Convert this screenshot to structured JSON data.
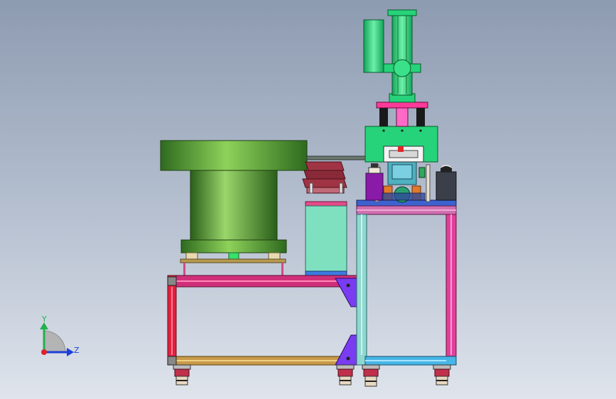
{
  "viewport": {
    "background_top": "#8d9bb1",
    "background_bottom": "#dfe4ec"
  },
  "triad": {
    "y_label": "Y",
    "z_label": "Z",
    "y_color": "#22b14c",
    "z_color": "#1f3fd6",
    "origin_color": "#e0202a"
  },
  "colors": {
    "bowl_green": "#3f8f2a",
    "pneumatic_green": "#26d37a",
    "frame_magenta": "#d0307a",
    "frame_red": "#e02040",
    "frame_tan": "#c79a4a",
    "frame_cyan": "#47b6e6",
    "bracket_purple": "#7a3cf0",
    "hopper_mint": "#7fe0c0",
    "chute_maroon": "#9a2a3a",
    "motor_purple": "#8a1aa8",
    "gearbox_dark": "#3a3f4a"
  }
}
